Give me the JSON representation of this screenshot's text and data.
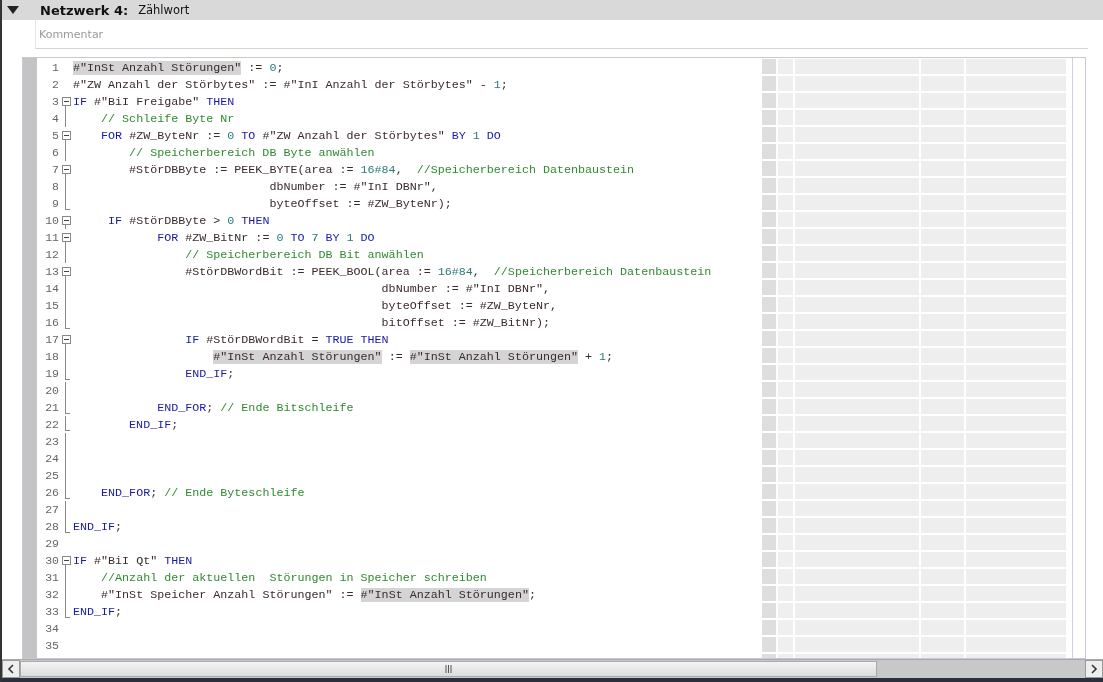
{
  "network": {
    "expanded": true,
    "label": "Netzwerk 4:",
    "title": "Zählwort",
    "comment": {
      "placeholder": "Kommentar"
    }
  },
  "code_lines": [
    {
      "number": "1",
      "kind": "plain",
      "tokens": [
        {
          "kind": "highlight",
          "text": "#\"InSt Anzahl Störungen\""
        },
        {
          "kind": "plain",
          "text": " := "
        },
        {
          "kind": "number",
          "text": "0"
        },
        {
          "kind": "plain",
          "text": ";"
        }
      ]
    },
    {
      "number": "2",
      "kind": "plain",
      "tokens": [
        {
          "kind": "plain",
          "text": "#\"ZW Anzahl der Störbytes\" := #\"InI Anzahl der Störbytes\" - "
        },
        {
          "kind": "number",
          "text": "1"
        },
        {
          "kind": "plain",
          "text": ";"
        }
      ]
    },
    {
      "number": "3",
      "kind": "start",
      "tokens": [
        {
          "kind": "keyword",
          "text": "IF"
        },
        {
          "kind": "plain",
          "text": " #\"BiI Freigabe\" "
        },
        {
          "kind": "keyword",
          "text": "THEN"
        }
      ]
    },
    {
      "number": "4",
      "kind": "line",
      "tokens": [
        {
          "kind": "comment",
          "text": "    // Schleife Byte Nr"
        }
      ]
    },
    {
      "number": "5",
      "kind": "start",
      "tokens": [
        {
          "kind": "keyword",
          "text": "    FOR"
        },
        {
          "kind": "plain",
          "text": " #ZW_ByteNr := "
        },
        {
          "kind": "number",
          "text": "0"
        },
        {
          "kind": "keyword",
          "text": " TO"
        },
        {
          "kind": "plain",
          "text": " #\"ZW Anzahl der Störbytes\" "
        },
        {
          "kind": "keyword",
          "text": "BY"
        },
        {
          "kind": "number",
          "text": " 1"
        },
        {
          "kind": "keyword",
          "text": " DO"
        }
      ]
    },
    {
      "number": "6",
      "kind": "line",
      "tokens": [
        {
          "kind": "comment",
          "text": "        // Speicherbereich DB Byte anwählen"
        }
      ]
    },
    {
      "number": "7",
      "kind": "start",
      "tokens": [
        {
          "kind": "plain",
          "text": "        #StörDBByte := PEEK_BYTE(area := "
        },
        {
          "kind": "number",
          "text": "16#84"
        },
        {
          "kind": "plain",
          "text": ",  "
        },
        {
          "kind": "comment",
          "text": "//Speicherbereich Datenbaustein"
        }
      ]
    },
    {
      "number": "8",
      "kind": "line",
      "tokens": [
        {
          "kind": "plain",
          "text": "                            dbNumber := #\"InI DBNr\","
        }
      ]
    },
    {
      "number": "9",
      "kind": "end",
      "tokens": [
        {
          "kind": "plain",
          "text": "                            byteOffset := #ZW_ByteNr);"
        }
      ]
    },
    {
      "number": "10",
      "kind": "start",
      "tokens": [
        {
          "kind": "keyword",
          "text": "     IF"
        },
        {
          "kind": "plain",
          "text": " #StörDBByte > "
        },
        {
          "kind": "number",
          "text": "0"
        },
        {
          "kind": "keyword",
          "text": " THEN"
        }
      ]
    },
    {
      "number": "11",
      "kind": "start",
      "tokens": [
        {
          "kind": "keyword",
          "text": "            FOR"
        },
        {
          "kind": "plain",
          "text": " #ZW_BitNr := "
        },
        {
          "kind": "number",
          "text": "0"
        },
        {
          "kind": "keyword",
          "text": " TO"
        },
        {
          "kind": "number",
          "text": " 7"
        },
        {
          "kind": "keyword",
          "text": " BY"
        },
        {
          "kind": "number",
          "text": " 1"
        },
        {
          "kind": "keyword",
          "text": " DO"
        }
      ]
    },
    {
      "number": "12",
      "kind": "line",
      "tokens": [
        {
          "kind": "comment",
          "text": "                // Speicherbereich DB Bit anwählen"
        }
      ]
    },
    {
      "number": "13",
      "kind": "start",
      "tokens": [
        {
          "kind": "plain",
          "text": "                #StörDBWordBit := PEEK_BOOL(area := "
        },
        {
          "kind": "number",
          "text": "16#84"
        },
        {
          "kind": "plain",
          "text": ",  "
        },
        {
          "kind": "comment",
          "text": "//Speicherbereich Datenbaustein"
        }
      ]
    },
    {
      "number": "14",
      "kind": "line",
      "tokens": [
        {
          "kind": "plain",
          "text": "                                            dbNumber := #\"InI DBNr\","
        }
      ]
    },
    {
      "number": "15",
      "kind": "line",
      "tokens": [
        {
          "kind": "plain",
          "text": "                                            byteOffset := #ZW_ByteNr,"
        }
      ]
    },
    {
      "number": "16",
      "kind": "end",
      "tokens": [
        {
          "kind": "plain",
          "text": "                                            bitOffset := #ZW_BitNr);"
        }
      ]
    },
    {
      "number": "17",
      "kind": "start",
      "tokens": [
        {
          "kind": "keyword",
          "text": "                IF"
        },
        {
          "kind": "plain",
          "text": " #StörDBWordBit = "
        },
        {
          "kind": "keyword",
          "text": "TRUE THEN"
        }
      ]
    },
    {
      "number": "18",
      "kind": "line",
      "tokens": [
        {
          "kind": "highlight",
          "text": "                    #\"InSt Anzahl Störungen\""
        },
        {
          "kind": "plain",
          "text": " := "
        },
        {
          "kind": "highlight",
          "text": "#\"InSt Anzahl Störungen\""
        },
        {
          "kind": "plain",
          "text": " + "
        },
        {
          "kind": "number",
          "text": "1"
        },
        {
          "kind": "plain",
          "text": ";"
        }
      ]
    },
    {
      "number": "19",
      "kind": "end",
      "tokens": [
        {
          "kind": "keyword",
          "text": "                END_IF"
        },
        {
          "kind": "plain",
          "text": ";"
        }
      ]
    },
    {
      "number": "20",
      "kind": "line"
    },
    {
      "number": "21",
      "kind": "end",
      "tokens": [
        {
          "kind": "keyword",
          "text": "            END_FOR"
        },
        {
          "kind": "plain",
          "text": "; "
        },
        {
          "kind": "comment",
          "text": "// Ende Bitschleife"
        }
      ]
    },
    {
      "number": "22",
      "kind": "end",
      "tokens": [
        {
          "kind": "keyword",
          "text": "        END_IF"
        },
        {
          "kind": "plain",
          "text": ";"
        }
      ]
    },
    {
      "number": "23",
      "kind": "line"
    },
    {
      "number": "24",
      "kind": "line"
    },
    {
      "number": "25",
      "kind": "line"
    },
    {
      "number": "26",
      "kind": "end",
      "tokens": [
        {
          "kind": "keyword",
          "text": "    END_FOR"
        },
        {
          "kind": "plain",
          "text": "; "
        },
        {
          "kind": "comment",
          "text": "// Ende Byteschleife"
        }
      ]
    },
    {
      "number": "27",
      "kind": "line"
    },
    {
      "number": "28",
      "kind": "end",
      "tokens": [
        {
          "kind": "keyword",
          "text": "END_IF"
        },
        {
          "kind": "plain",
          "text": ";"
        }
      ]
    },
    {
      "number": "29",
      "kind": "plain"
    },
    {
      "number": "30",
      "kind": "start",
      "tokens": [
        {
          "kind": "keyword",
          "text": "IF"
        },
        {
          "kind": "plain",
          "text": " #\"BiI Qt\" "
        },
        {
          "kind": "keyword",
          "text": "THEN"
        }
      ]
    },
    {
      "number": "31",
      "kind": "line",
      "tokens": [
        {
          "kind": "comment",
          "text": "    //Anzahl der aktuellen  Störungen in Speicher schreiben"
        }
      ]
    },
    {
      "number": "32",
      "kind": "line",
      "tokens": [
        {
          "kind": "plain",
          "text": "    #\"InSt Speicher Anzahl Störungen\" := "
        },
        {
          "kind": "highlight",
          "text": "#\"InSt Anzahl Störungen\""
        },
        {
          "kind": "plain",
          "text": ";"
        }
      ]
    },
    {
      "number": "33",
      "kind": "end",
      "tokens": [
        {
          "kind": "keyword",
          "text": "END_IF"
        },
        {
          "kind": "plain",
          "text": ";"
        }
      ]
    },
    {
      "number": "34",
      "kind": "plain"
    },
    {
      "number": "35",
      "kind": "plain"
    }
  ]
}
